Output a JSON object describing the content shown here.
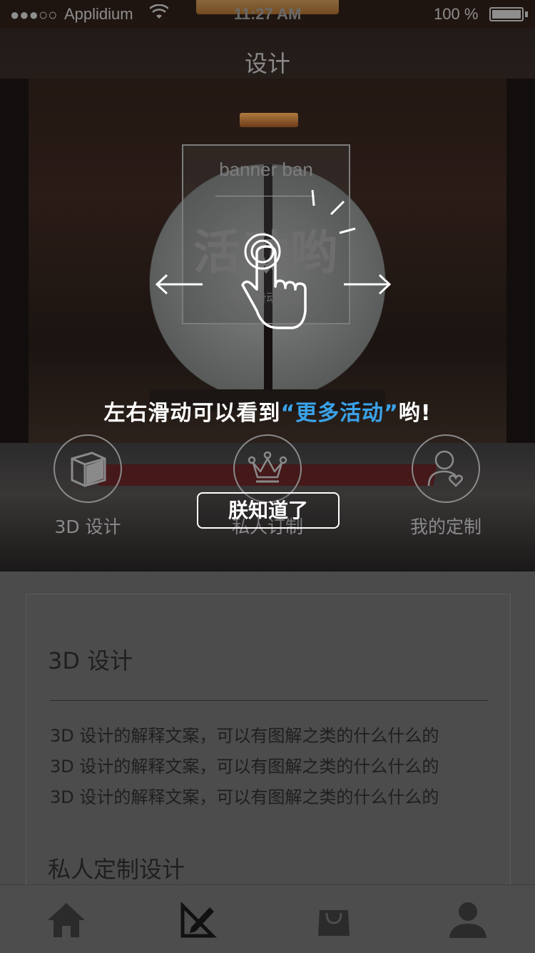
{
  "status_bar": {
    "signal": "●●●○○",
    "carrier": "Applidium",
    "time": "11:27 AM",
    "battery": "100 %"
  },
  "header": {
    "title": "设计"
  },
  "banner": {
    "placeholder": "banner ban",
    "headline": "活动哟",
    "subtitle": "可以滑动轮播"
  },
  "guide": {
    "tip_prefix": "左右滑动可以看到",
    "tip_highlight": "“更多活动”",
    "tip_suffix": "哟!",
    "dismiss_label": "朕知道了"
  },
  "categories": [
    {
      "label": "3D 设计",
      "icon": "cube-icon"
    },
    {
      "label": "私人订制",
      "icon": "crown-icon"
    },
    {
      "label": "我的定制",
      "icon": "user-heart-icon"
    }
  ],
  "content": {
    "section1_title": "3D 设计",
    "section1_lines": [
      "3D 设计的解释文案，可以有图解之类的什么什么的",
      "3D 设计的解释文案，可以有图解之类的什么什么的",
      "3D 设计的解释文案，可以有图解之类的什么什么的"
    ],
    "section2_title": "私人定制设计"
  },
  "tabbar": {
    "items": [
      {
        "icon": "home-icon"
      },
      {
        "icon": "design-icon",
        "active": true
      },
      {
        "icon": "shopping-bag-icon"
      },
      {
        "icon": "profile-icon"
      }
    ]
  },
  "colors": {
    "highlight": "#3aa3ea",
    "overlay_text": "#ffffff",
    "muted": "#8a8a8a",
    "content_bg": "#4b4b4b"
  }
}
